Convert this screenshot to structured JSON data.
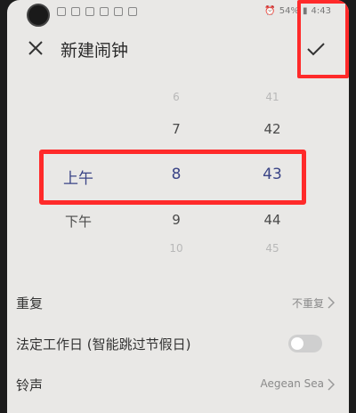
{
  "status_bar": {
    "battery": "54%",
    "time": "4:43"
  },
  "header": {
    "title": "新建闹钟",
    "close_icon": "close-icon",
    "confirm_icon": "check-icon"
  },
  "time_picker": {
    "ampm": [
      "",
      "",
      "上午",
      "下午",
      ""
    ],
    "hours": [
      "6",
      "7",
      "8",
      "9",
      "10"
    ],
    "minutes": [
      "41",
      "42",
      "43",
      "44",
      "45"
    ],
    "selected": {
      "ampm": "上午",
      "hour": "8",
      "minute": "43"
    }
  },
  "settings": {
    "repeat": {
      "label": "重复",
      "value": "不重复"
    },
    "workday": {
      "label": "法定工作日 (智能跳过节假日)",
      "enabled": false
    },
    "ringtone": {
      "label": "铃声",
      "value": "Aegean Sea"
    }
  },
  "colors": {
    "highlight": "#ff2a2a",
    "selected_text": "#3a4486"
  }
}
